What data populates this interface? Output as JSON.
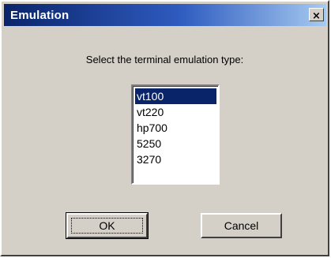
{
  "dialog": {
    "title": "Emulation",
    "close_glyph": "×"
  },
  "prompt": "Select the terminal emulation type:",
  "emulation_list": {
    "items": [
      "vt100",
      "vt220",
      "hp700",
      "5250",
      "3270"
    ],
    "selected_index": 0
  },
  "buttons": {
    "ok_label": "OK",
    "cancel_label": "Cancel"
  },
  "colors": {
    "title_gradient_start": "#0a246a",
    "title_gradient_end": "#a6caf0",
    "selection": "#0a246a",
    "face": "#d4d0c8"
  },
  "icons": {
    "close": "close-icon"
  }
}
